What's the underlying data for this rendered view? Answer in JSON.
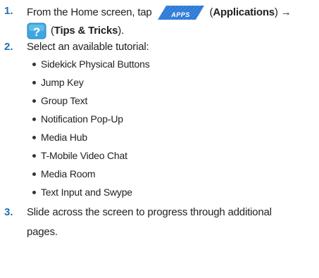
{
  "steps": [
    {
      "number": "1.",
      "text_before": "From the Home screen, tap",
      "apps_button_label": "APPS",
      "applications_label": "Applications",
      "arrow": "→",
      "tips_label": "Tips & Tricks",
      "open_paren": "(",
      "close_paren": ")",
      "close_paren_period": ")."
    },
    {
      "number": "2.",
      "text": "Select an available tutorial:"
    },
    {
      "number": "3.",
      "line1": "Slide across the screen to progress through additional",
      "line2": "pages."
    }
  ],
  "tutorials": [
    "Sidekick Physical Buttons",
    "Jump Key",
    "Group Text",
    "Notification Pop-Up",
    "Media Hub",
    "T-Mobile Video Chat",
    "Media Room",
    "Text Input and Swype"
  ],
  "colors": {
    "step_number": "#1f6fb3",
    "apps_button": "#2e7bd6",
    "tips_icon": "#3ea7e0"
  },
  "icons": {
    "apps_button": "apps-button-icon",
    "tips": "tips-and-tricks-icon"
  }
}
